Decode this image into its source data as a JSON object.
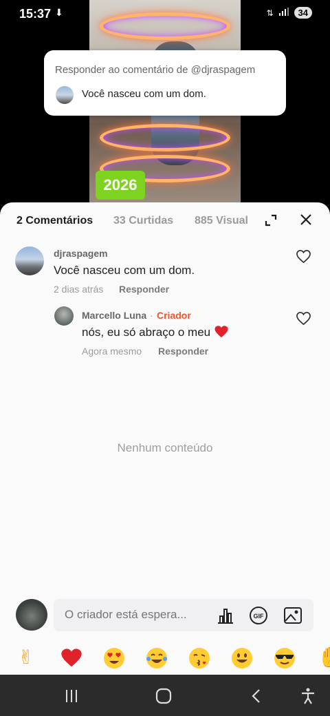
{
  "status_bar": {
    "time": "15:37",
    "battery": "34"
  },
  "video": {
    "year_badge": "2026"
  },
  "reply_popup": {
    "title": "Responder ao comentário de @djraspagem",
    "quoted_text": "Você nasceu com um dom."
  },
  "tabs": [
    {
      "label": "2 Comentários",
      "active": true
    },
    {
      "label": "33 Curtidas",
      "active": false
    },
    {
      "label": "885 Visual",
      "active": false
    }
  ],
  "comment": {
    "username": "djraspagem",
    "text": "Você nasceu com um dom.",
    "time": "2 dias atrás",
    "reply_label": "Responder"
  },
  "reply": {
    "username": "Marcello Luna",
    "separator": "·",
    "badge": "Criador",
    "text": "nós, eu só  abraço  o meu",
    "time": "Agora mesmo",
    "reply_label": "Responder"
  },
  "empty_state": "Nenhum conteúdo",
  "composer": {
    "placeholder": "O criador está espera..."
  },
  "colors": {
    "accent": "#f2532a",
    "year_badge": "#7ed321",
    "heart": "#e0222b"
  },
  "emoji_row": [
    "hand-icon",
    "heart-icon",
    "heart-eyes-icon",
    "tears-of-joy-icon",
    "kiss-icon",
    "smile-icon",
    "sunglasses-icon",
    "clap-icon"
  ]
}
